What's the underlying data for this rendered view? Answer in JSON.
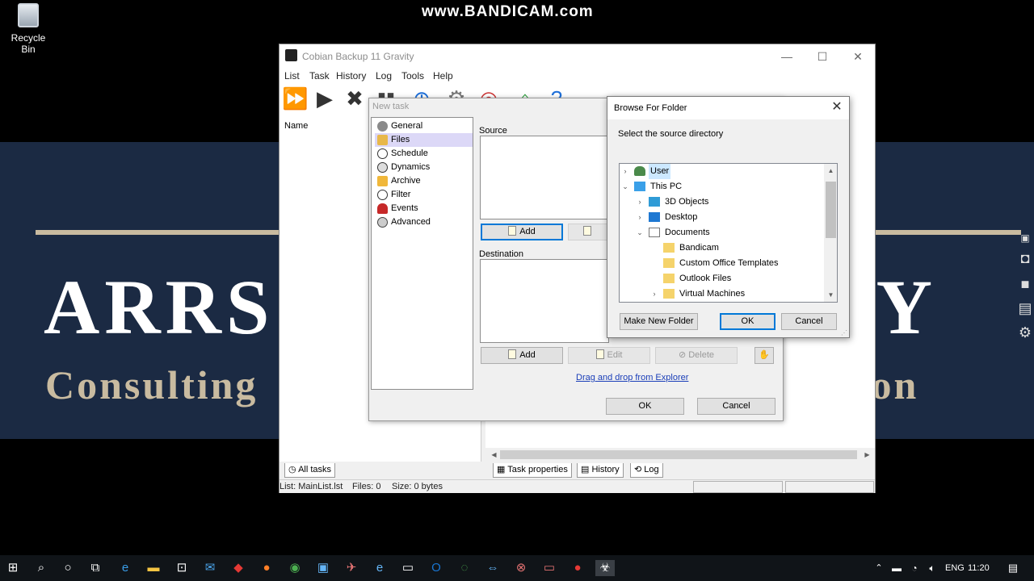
{
  "desktop": {
    "watermark": "www.BANDICAM.com",
    "recycle_bin_label": "Recycle Bin",
    "banner_left": "ARRS",
    "banner_right": "GY",
    "banner_sub_left": "Consulting",
    "banner_sub_right": "ation",
    "banner_accent": "#c9bba0",
    "banner_bg": "#1b2a43"
  },
  "main_window": {
    "title": "Cobian Backup 11 Gravity",
    "menu": [
      "List",
      "Task",
      "History",
      "Log",
      "Tools",
      "Help"
    ],
    "left_column_header": "Name",
    "bottom_tabs": {
      "all_tasks": "All tasks",
      "task_properties": "Task properties",
      "history": "History",
      "log": "Log"
    },
    "status": {
      "list": "List: MainList.lst",
      "files": "Files: 0",
      "size": "Size: 0 bytes"
    }
  },
  "new_task": {
    "title": "New task",
    "nav": [
      "General",
      "Files",
      "Schedule",
      "Dynamics",
      "Archive",
      "Filter",
      "Events",
      "Advanced"
    ],
    "selected_nav": "Files",
    "source_label": "Source",
    "destination_label": "Destination",
    "add": "Add",
    "edit": "Edit",
    "delete": "Delete",
    "drag_drop": "Drag and drop from Explorer",
    "ok": "OK",
    "cancel": "Cancel"
  },
  "browse": {
    "title": "Browse For Folder",
    "prompt": "Select the source directory",
    "tree": {
      "user": "User",
      "this_pc": "This PC",
      "objects3d": "3D Objects",
      "desktop": "Desktop",
      "documents": "Documents",
      "bandicam": "Bandicam",
      "custom_office": "Custom Office Templates",
      "outlook": "Outlook Files",
      "virtual_machines": "Virtual Machines"
    },
    "make_new_folder": "Make New Folder",
    "ok": "OK",
    "cancel": "Cancel"
  },
  "taskbar": {
    "language": "ENG",
    "time": "11:20"
  }
}
